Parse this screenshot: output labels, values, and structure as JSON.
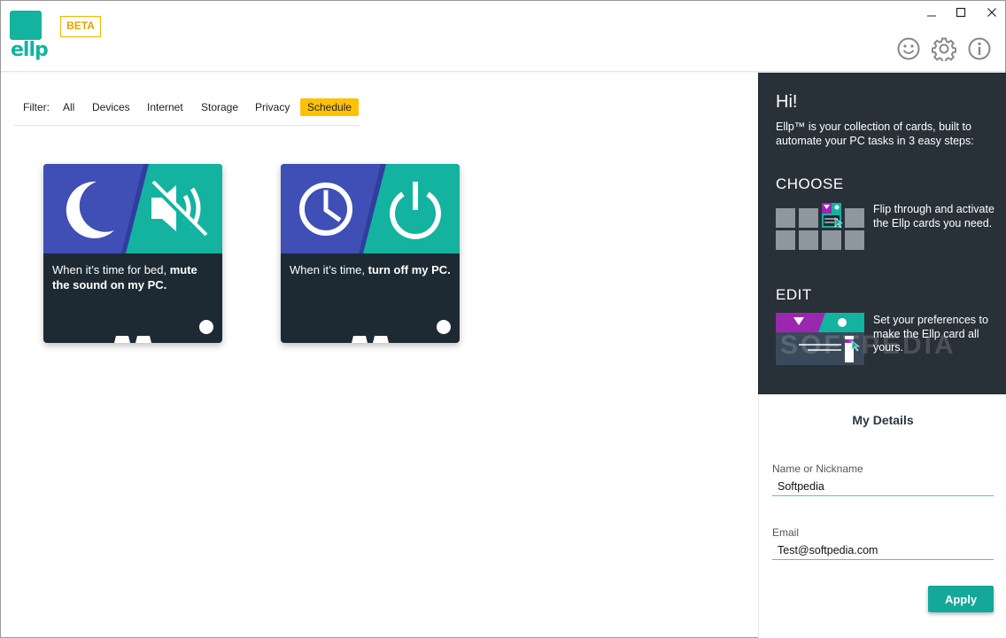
{
  "app": {
    "logo_text": "ellp",
    "badge": "BETA",
    "window_controls": [
      "minimize-icon",
      "maximize-icon",
      "close-icon"
    ],
    "header_icons": [
      "smiley-icon",
      "gear-icon",
      "info-icon"
    ]
  },
  "filter": {
    "label": "Filter:",
    "items": [
      "All",
      "Devices",
      "Internet",
      "Storage",
      "Privacy",
      "Schedule"
    ],
    "active": "Schedule",
    "active_color": "#ffc107"
  },
  "cards": [
    {
      "text_plain": "When it’s time for bed, ",
      "text_bold": "mute the sound on my PC.",
      "left_icon": "moon-icon",
      "right_icon": "speaker-muted-icon"
    },
    {
      "text_plain": "When it’s time, ",
      "text_bold": "turn off my PC.",
      "left_icon": "clock-icon",
      "right_icon": "power-icon"
    }
  ],
  "colors": {
    "teal": "#13b3a0",
    "indigo": "#3f4fb6",
    "card_bg": "#1e2a33",
    "panel_bg": "#283038",
    "purple": "#9b27b0"
  },
  "panel": {
    "greeting": "Hi!",
    "intro": "Ellp™ is your collection of cards, built to automate your PC tasks in 3 easy steps:",
    "steps": [
      {
        "title": "CHOOSE",
        "text": "Flip through and activate the Ellp cards you need."
      },
      {
        "title": "EDIT",
        "text": "Set your preferences to make the Ellp card all yours."
      }
    ]
  },
  "details": {
    "title": "My Details",
    "name_label": "Name or Nickname",
    "name_value": "Softpedia",
    "email_label": "Email",
    "email_value": "Test@softpedia.com",
    "apply_label": "Apply"
  },
  "watermark": "SOFTPEDIA"
}
